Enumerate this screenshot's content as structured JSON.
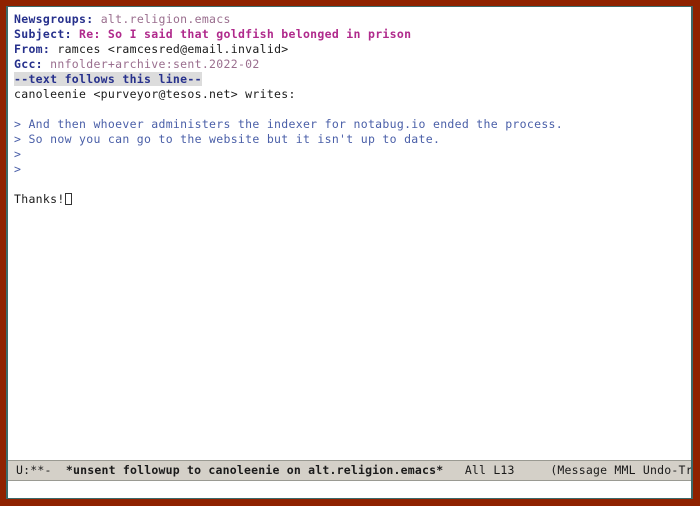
{
  "window": {
    "frame_border_color": "#8f2200",
    "inner_border_color": "#3b6a6a",
    "buffer_background": "#ffffff"
  },
  "headers": [
    {
      "name": "Newsgroups:",
      "value": "alt.religion.emacs",
      "value_style": "muted",
      "value_color": "#9a6e8e"
    },
    {
      "name": "Subject:",
      "value": "Re: So I said that goldfish belonged in prison",
      "value_style": "subject",
      "value_color": "#b02a8c"
    },
    {
      "name": "From:",
      "value": "ramces <ramcesred@email.invalid>",
      "value_style": "plain",
      "value_color": "#1a1a1a"
    },
    {
      "name": "Gcc:",
      "value": "nnfolder+archive:sent.2022-02",
      "value_style": "muted",
      "value_color": "#9a6e8e"
    }
  ],
  "header_name_color": "#26308c",
  "separator": {
    "text": "--text follows this line--",
    "color": "#26308c",
    "background": "#dcdcdc"
  },
  "body": {
    "attribution": "canoleenie <purveyor@tesos.net> writes:",
    "cite_color": "#4a5fa8",
    "lines": [
      {
        "type": "blank",
        "text": ""
      },
      {
        "type": "cited",
        "text": "> And then whoever administers the indexer for notabug.io ended the process."
      },
      {
        "type": "cited",
        "text": "> So now you can go to the website but it isn't up to date."
      },
      {
        "type": "cited",
        "text": ">"
      },
      {
        "type": "cited",
        "text": ">"
      },
      {
        "type": "blank",
        "text": ""
      },
      {
        "type": "signoff",
        "text": "Thanks!"
      }
    ]
  },
  "cursor": {
    "style": "hollow-box",
    "color": "#333333"
  },
  "mode_line": {
    "background": "#d4d0c8",
    "foreground": "#1a1a1a",
    "coding_status": "U:**-",
    "gap_1": "  ",
    "buffer_name": "*unsent followup to canoleenie on alt.religion.emacs*",
    "gap_2": "   ",
    "position_scroll": "All",
    "gap_3": " ",
    "position_line": "L13",
    "gap_4": "     ",
    "modes": "(Message MML Undo-Tree"
  },
  "echo_area": {
    "text": ""
  }
}
